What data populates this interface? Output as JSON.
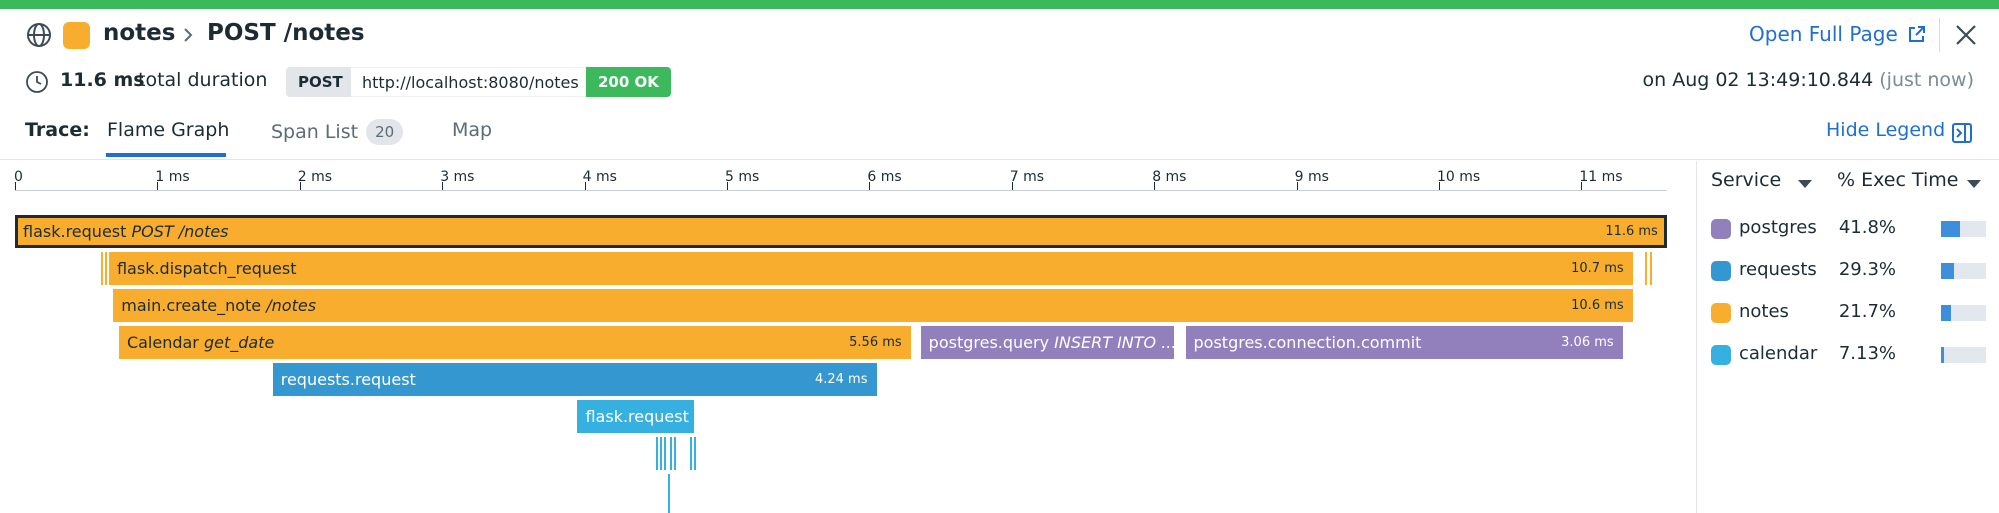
{
  "header": {
    "service_name": "notes",
    "resource_name": "POST /notes",
    "open_full_page": "Open Full Page",
    "service_color": "#f8ad2f"
  },
  "summary": {
    "duration_value": "11.6 ms",
    "duration_label": "total duration",
    "method": "POST",
    "url": "http://localhost:8080/notes",
    "status": "200 OK",
    "date": "on Aug 02 13:49:10.844",
    "date_relative": "(just now)"
  },
  "tabs": {
    "trace_label": "Trace:",
    "items": [
      {
        "label": "Flame Graph",
        "active": true
      },
      {
        "label": "Span List",
        "count": "20",
        "active": false
      },
      {
        "label": "Map",
        "active": false
      }
    ],
    "hide_legend": "Hide Legend"
  },
  "flame": {
    "axis_ticks": [
      "0",
      "1 ms",
      "2 ms",
      "3 ms",
      "4 ms",
      "5 ms",
      "6 ms",
      "7 ms",
      "8 ms",
      "9 ms",
      "10 ms",
      "11 ms"
    ],
    "spans": [
      {
        "name": "flask.request",
        "resource": "POST /notes",
        "duration": "11.6 ms",
        "start_ms": 0,
        "end_ms": 11.6,
        "depth": 0,
        "service": "notes",
        "selected": true
      },
      {
        "name": "flask.dispatch_request",
        "resource": "",
        "duration": "10.7 ms",
        "start_ms": 0.66,
        "end_ms": 11.36,
        "depth": 1,
        "service": "notes"
      },
      {
        "name": "main.create_note",
        "resource": "/notes",
        "duration": "10.6 ms",
        "start_ms": 0.69,
        "end_ms": 11.36,
        "depth": 2,
        "service": "notes"
      },
      {
        "name": "Calendar",
        "resource": "get_date",
        "duration": "5.56 ms",
        "start_ms": 0.73,
        "end_ms": 6.29,
        "depth": 3,
        "service": "notes"
      },
      {
        "name": "postgres.query",
        "resource": "INSERT INTO ...",
        "duration": "",
        "start_ms": 6.36,
        "end_ms": 8.14,
        "depth": 3,
        "service": "postgres"
      },
      {
        "name": "postgres.connection.commit",
        "resource": "",
        "duration": "3.06 ms",
        "start_ms": 8.22,
        "end_ms": 11.29,
        "depth": 3,
        "service": "postgres"
      },
      {
        "name": "requests.request",
        "resource": "",
        "duration": "4.24 ms",
        "start_ms": 1.81,
        "end_ms": 6.05,
        "depth": 4,
        "service": "requests"
      },
      {
        "name": "flask.request",
        "resource": "",
        "duration": "",
        "start_ms": 3.95,
        "end_ms": 4.77,
        "depth": 5,
        "service": "calendar"
      }
    ]
  },
  "legend": {
    "col_service": "Service",
    "col_exec": "% Exec Time",
    "rows": [
      {
        "service": "postgres",
        "pct": "41.8%",
        "fraction": 0.418,
        "color": "#9180bc"
      },
      {
        "service": "requests",
        "pct": "29.3%",
        "fraction": 0.293,
        "color": "#3597d0"
      },
      {
        "service": "notes",
        "pct": "21.7%",
        "fraction": 0.217,
        "color": "#f8ad2f"
      },
      {
        "service": "calendar",
        "pct": "7.13%",
        "fraction": 0.0713,
        "color": "#36b0e0"
      }
    ]
  },
  "colors": {
    "notes": "#f8ad2f",
    "postgres": "#9180bc",
    "requests": "#3597d0",
    "calendar": "#36b0e0",
    "accent": "#1f6fd1",
    "success": "#3cb95c"
  }
}
